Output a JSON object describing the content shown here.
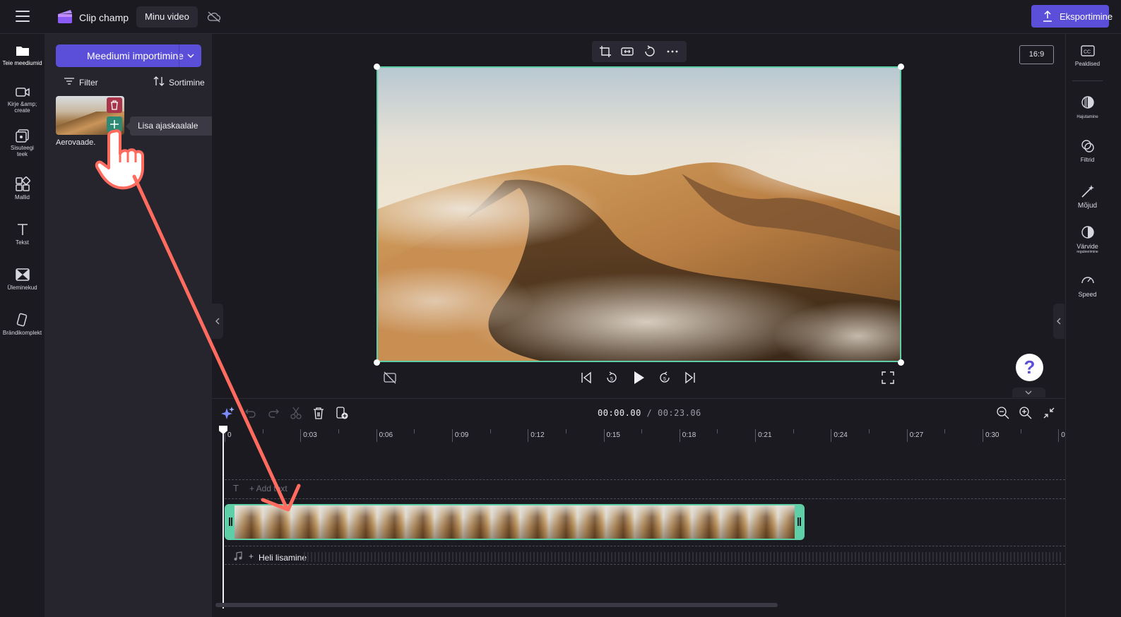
{
  "app": {
    "title": "Clip champ",
    "project_name": "Minu video",
    "export_label": "Eksportimine"
  },
  "left_nav": {
    "items": [
      {
        "label": "Teie meediumid",
        "icon": "folder-icon",
        "active": true
      },
      {
        "label": "Kirje &amp; create",
        "icon": "video-camera-icon"
      },
      {
        "label": "Sisuteegi teek",
        "icon": "content-library-icon"
      },
      {
        "label": "Mallid",
        "icon": "templates-icon"
      },
      {
        "label": "Tekst",
        "icon": "text-icon"
      },
      {
        "label": "Üleminekud",
        "icon": "transitions-icon"
      },
      {
        "label": "Brändikomplekt",
        "icon": "brand-kit-icon"
      }
    ]
  },
  "media_panel": {
    "import_label": "Meediumi importimine",
    "filter_label": "Filter",
    "sort_label": "Sortimine",
    "media_item_name": "Aerovaade.",
    "tooltip": "Lisa ajaskaalale"
  },
  "preview": {
    "aspect_ratio": "16:9",
    "help_label": "?"
  },
  "timeline": {
    "current_time": "00:00.00",
    "total_time": "/ 00:23.06",
    "ticks": [
      "0",
      "0:03",
      "0:06",
      "0:09",
      "0:12",
      "0:15",
      "0:18",
      "0:21",
      "0:24",
      "0:27",
      "0:30",
      "0"
    ],
    "text_track_label": "+ Add text",
    "audio_track_label": "Heli lisamine",
    "audio_plus": "+"
  },
  "right_nav": {
    "items": [
      {
        "label": "Pealdised",
        "icon": "captions-icon"
      },
      {
        "label": "Hajutamine",
        "icon": "fade-icon"
      },
      {
        "label": "Filtrid",
        "icon": "filters-icon"
      },
      {
        "label": "Mõjud",
        "icon": "effects-wand-icon"
      },
      {
        "label": "Värvide",
        "sublabel": "reguleerimine",
        "icon": "color-adjust-icon"
      },
      {
        "label": "Speed",
        "icon": "speed-gauge-icon"
      }
    ]
  },
  "colors": {
    "accent": "#5b4fd9",
    "selection": "#5fcfa8",
    "delete": "#a8354a",
    "annotation_arrow": "#ff6b5e"
  }
}
